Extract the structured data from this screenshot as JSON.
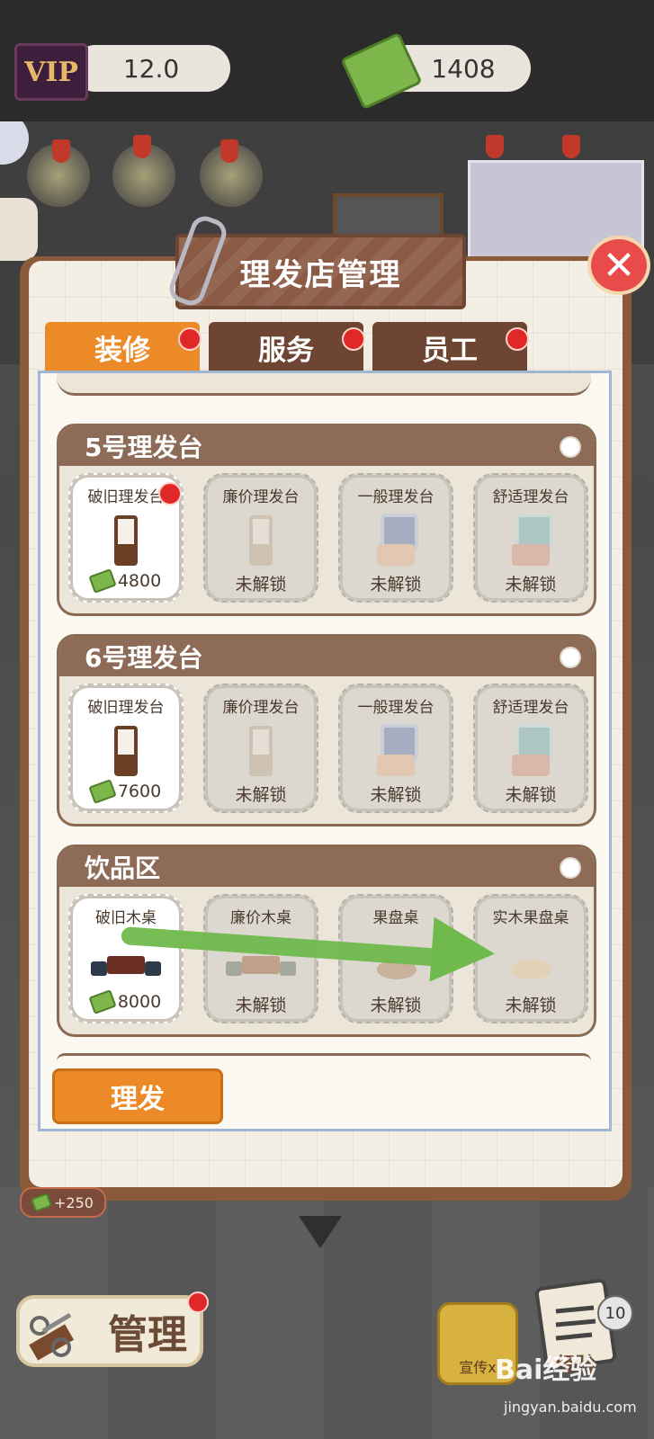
{
  "top_bar": {
    "vip_label": "VIP",
    "vip_level": "12.0",
    "money": "1408",
    "icons": [
      "vip-badge",
      "cash-icon"
    ]
  },
  "panel": {
    "title": "理发店管理",
    "close_icon": "close-icon"
  },
  "tabs": [
    {
      "label": "装修",
      "active": true,
      "has_dot": true
    },
    {
      "label": "服务",
      "active": false,
      "has_dot": true
    },
    {
      "label": "员工",
      "active": false,
      "has_dot": true
    }
  ],
  "sections": [
    {
      "title": "5号理发台",
      "items": [
        {
          "name": "破旧理发台",
          "bottom": "4800",
          "unlocked": true,
          "has_dot": true,
          "icon": "worn-chair"
        },
        {
          "name": "廉价理发台",
          "bottom": "未解锁",
          "unlocked": false,
          "icon": "cheap-vanity"
        },
        {
          "name": "一般理发台",
          "bottom": "未解锁",
          "unlocked": false,
          "icon": "normal-vanity"
        },
        {
          "name": "舒适理发台",
          "bottom": "未解锁",
          "unlocked": false,
          "icon": "comfort-vanity"
        }
      ]
    },
    {
      "title": "6号理发台",
      "items": [
        {
          "name": "破旧理发台",
          "bottom": "7600",
          "unlocked": true,
          "icon": "worn-chair"
        },
        {
          "name": "廉价理发台",
          "bottom": "未解锁",
          "unlocked": false,
          "icon": "cheap-vanity"
        },
        {
          "name": "一般理发台",
          "bottom": "未解锁",
          "unlocked": false,
          "icon": "normal-vanity"
        },
        {
          "name": "舒适理发台",
          "bottom": "未解锁",
          "unlocked": false,
          "icon": "comfort-vanity"
        }
      ]
    },
    {
      "title": "饮品区",
      "items": [
        {
          "name": "破旧木桌",
          "bottom": "8000",
          "unlocked": true,
          "icon": "worn-table"
        },
        {
          "name": "廉价木桌",
          "bottom": "未解锁",
          "unlocked": false,
          "icon": "cheap-table"
        },
        {
          "name": "果盘桌",
          "bottom": "未解锁",
          "unlocked": false,
          "icon": "fruit-table"
        },
        {
          "name": "实木果盘桌",
          "bottom": "未解锁",
          "unlocked": false,
          "icon": "wood-fruit-table"
        }
      ]
    }
  ],
  "cut_button": "理发",
  "income_badge": "+250",
  "bottom": {
    "manage_label": "管理",
    "promo_label": "宣传x",
    "exp_count": "10",
    "exp_label": "经验"
  },
  "watermark": {
    "brand": "Bai经验",
    "url": "jingyan.baidu.com"
  },
  "colors": {
    "accent_orange": "#ec8a27",
    "tab_brown": "#6e4532",
    "section_header": "#8d6b57",
    "guide_arrow": "#6fb94d",
    "notification_red": "#e02828"
  }
}
